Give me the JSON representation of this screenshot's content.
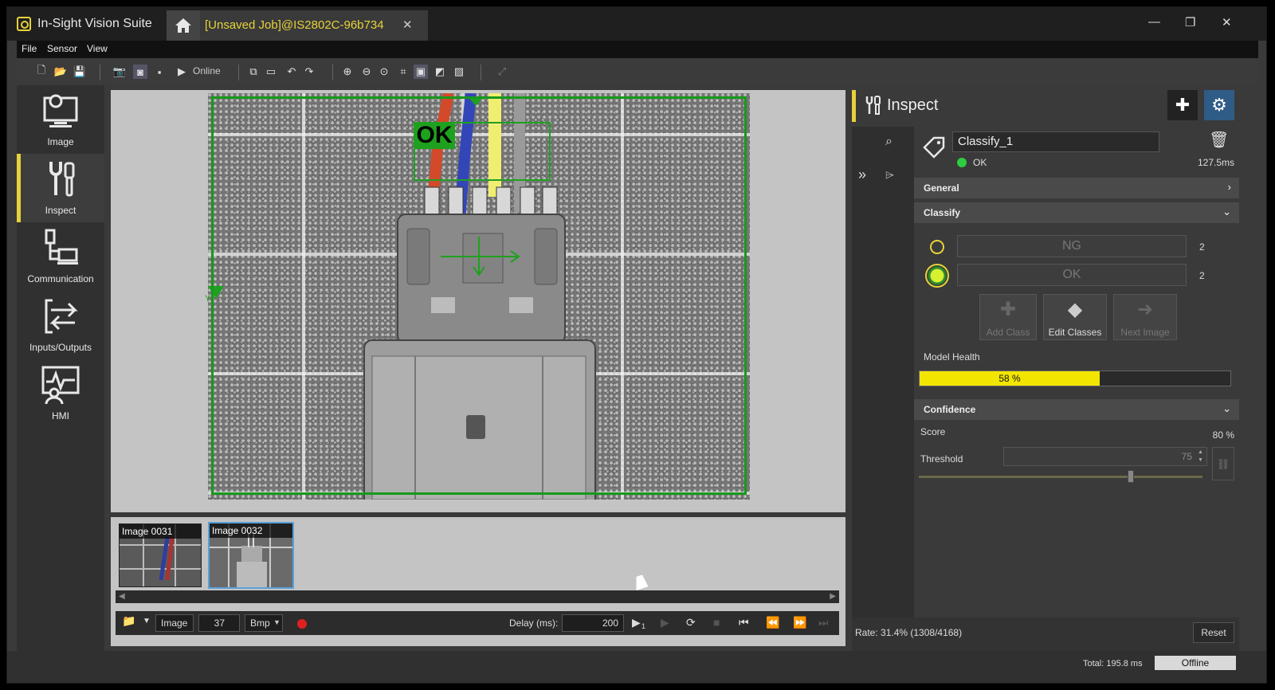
{
  "app": {
    "title": "In-Sight Vision Suite",
    "job_tab": "[Unsaved Job]@IS2802C-96b734"
  },
  "menu": [
    "File",
    "Sensor",
    "View"
  ],
  "toolbar": {
    "online_label": "Online"
  },
  "nav": [
    {
      "label": "Image",
      "icon": "monitor-gear-icon",
      "active": false
    },
    {
      "label": "Inspect",
      "icon": "tools-icon",
      "active": true
    },
    {
      "label": "Communication",
      "icon": "network-icon",
      "active": false
    },
    {
      "label": "Inputs/Outputs",
      "icon": "io-arrows-icon",
      "active": false
    },
    {
      "label": "HMI",
      "icon": "hmi-icon",
      "active": false
    }
  ],
  "image_view": {
    "overlay_text": "OK",
    "axis_label": "Y"
  },
  "thumbnails": [
    {
      "label": "Image 0031",
      "selected": false
    },
    {
      "label": "Image 0032",
      "selected": true
    }
  ],
  "player": {
    "source": "Image",
    "index": "37",
    "format": "Bmp",
    "delay_label": "Delay (ms):",
    "delay_value": "200",
    "step_subscript": "1"
  },
  "inspect": {
    "title": "Inspect",
    "tool_name": "Classify_1",
    "status": "OK",
    "time": "127.5ms",
    "sections": {
      "general": "General",
      "classify": "Classify",
      "confidence": "Confidence"
    },
    "classes": [
      {
        "name": "NG",
        "count": "2",
        "selected": false
      },
      {
        "name": "OK",
        "count": "2",
        "selected": true
      }
    ],
    "actions": {
      "add": "Add Class",
      "edit": "Edit Classes",
      "next": "Next Image"
    },
    "model_health_label": "Model Health",
    "model_health_value": "58 %",
    "model_health_fraction": 0.58,
    "score_label": "Score",
    "score_value": "80 %",
    "threshold_label": "Threshold",
    "threshold_value": "75",
    "rate": "Rate:  31.4% (1308/4168)",
    "reset_label": "Reset"
  },
  "status_bar": {
    "total": "Total: 195.8 ms",
    "mode": "Offline"
  },
  "colors": {
    "accent": "#e6d23a",
    "roi_green": "#1ea11e",
    "status_ok": "#2ecc40",
    "health_fill": "#f2e600"
  }
}
